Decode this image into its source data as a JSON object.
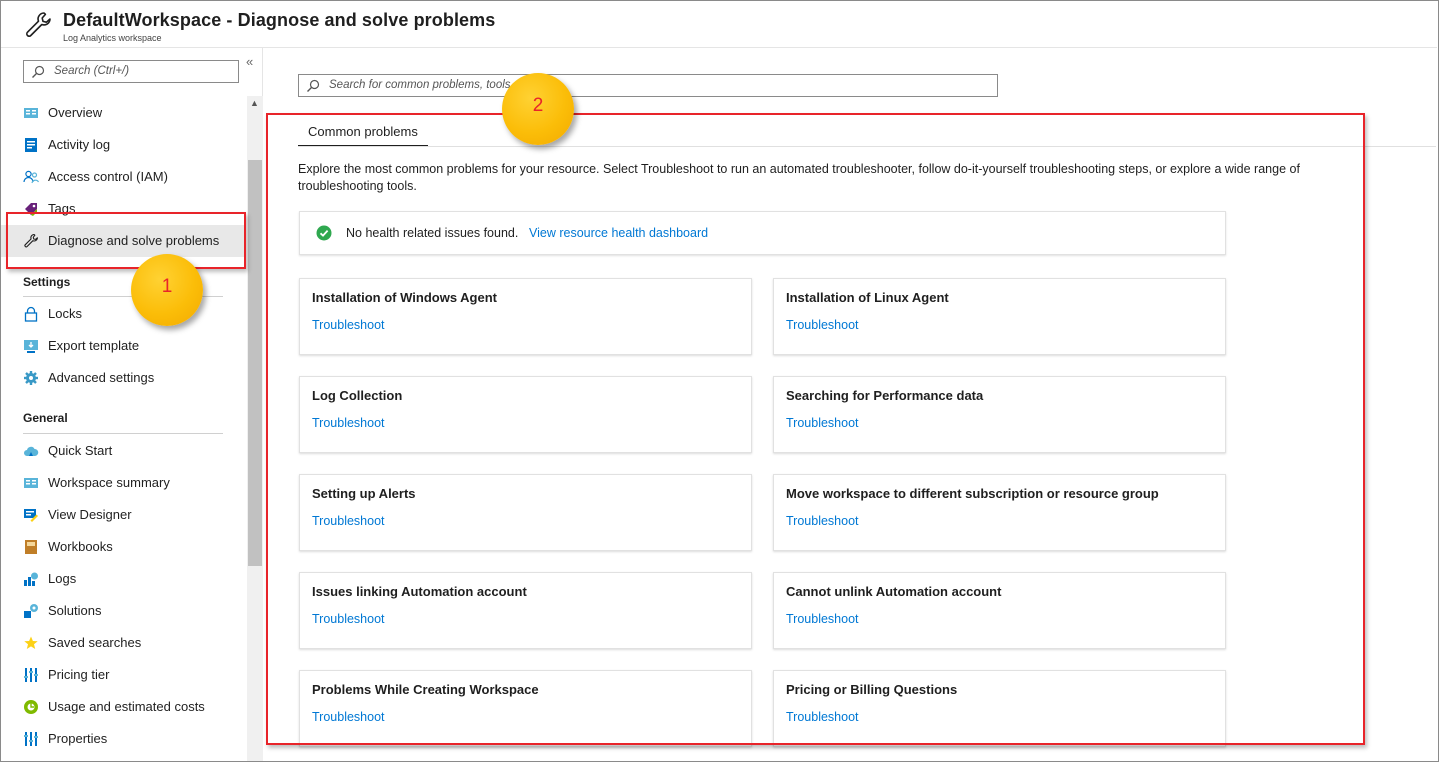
{
  "header": {
    "title": "DefaultWorkspace - Diagnose and solve problems",
    "subtitle": "Log Analytics workspace",
    "icon": "wrench-icon"
  },
  "sidebar": {
    "search_placeholder": "Search (Ctrl+/)",
    "collapse_glyph": "«",
    "items_top": [
      {
        "label": "Overview",
        "icon": "overview-icon"
      },
      {
        "label": "Activity log",
        "icon": "activity-log-icon"
      },
      {
        "label": "Access control (IAM)",
        "icon": "iam-icon"
      },
      {
        "label": "Tags",
        "icon": "tag-icon"
      },
      {
        "label": "Diagnose and solve problems",
        "icon": "wrench-icon",
        "active": true
      }
    ],
    "settings_title": "Settings",
    "settings_items": [
      {
        "label": "Locks",
        "icon": "lock-icon"
      },
      {
        "label": "Export template",
        "icon": "export-template-icon"
      },
      {
        "label": "Advanced settings",
        "icon": "gear-icon"
      }
    ],
    "general_title": "General",
    "general_items": [
      {
        "label": "Quick Start",
        "icon": "cloud-icon"
      },
      {
        "label": "Workspace summary",
        "icon": "summary-icon"
      },
      {
        "label": "View Designer",
        "icon": "view-designer-icon"
      },
      {
        "label": "Workbooks",
        "icon": "workbook-icon"
      },
      {
        "label": "Logs",
        "icon": "logs-icon"
      },
      {
        "label": "Solutions",
        "icon": "solutions-icon"
      },
      {
        "label": "Saved searches",
        "icon": "star-icon"
      },
      {
        "label": "Pricing tier",
        "icon": "pricing-icon"
      },
      {
        "label": "Usage and estimated costs",
        "icon": "usage-icon"
      },
      {
        "label": "Properties",
        "icon": "properties-icon"
      }
    ]
  },
  "main": {
    "search_placeholder": "Search for common problems, tools",
    "tab_label": "Common problems",
    "intro": "Explore the most common problems for your resource. Select Troubleshoot to run an automated troubleshooter, follow do-it-yourself troubleshooting steps, or explore a wide range of troubleshooting tools.",
    "health_message": "No health related issues found.",
    "health_link": "View resource health dashboard",
    "cards": [
      {
        "title": "Installation of Windows Agent",
        "link": "Troubleshoot"
      },
      {
        "title": "Installation of Linux Agent",
        "link": "Troubleshoot"
      },
      {
        "title": "Log Collection",
        "link": "Troubleshoot"
      },
      {
        "title": "Searching for Performance data",
        "link": "Troubleshoot"
      },
      {
        "title": "Setting up Alerts",
        "link": "Troubleshoot"
      },
      {
        "title": "Move workspace to different subscription or resource group",
        "link": "Troubleshoot"
      },
      {
        "title": "Issues linking Automation account",
        "link": "Troubleshoot"
      },
      {
        "title": "Cannot unlink Automation account",
        "link": "Troubleshoot"
      },
      {
        "title": "Problems While Creating Workspace",
        "link": "Troubleshoot"
      },
      {
        "title": "Pricing or Billing Questions",
        "link": "Troubleshoot"
      }
    ]
  },
  "annotations": {
    "badge_1": "1",
    "badge_2": "2",
    "highlight_color": "#e8242a",
    "badge_color": "#fbbd08"
  },
  "colors": {
    "link": "#0078d4",
    "success": "#107c10"
  }
}
